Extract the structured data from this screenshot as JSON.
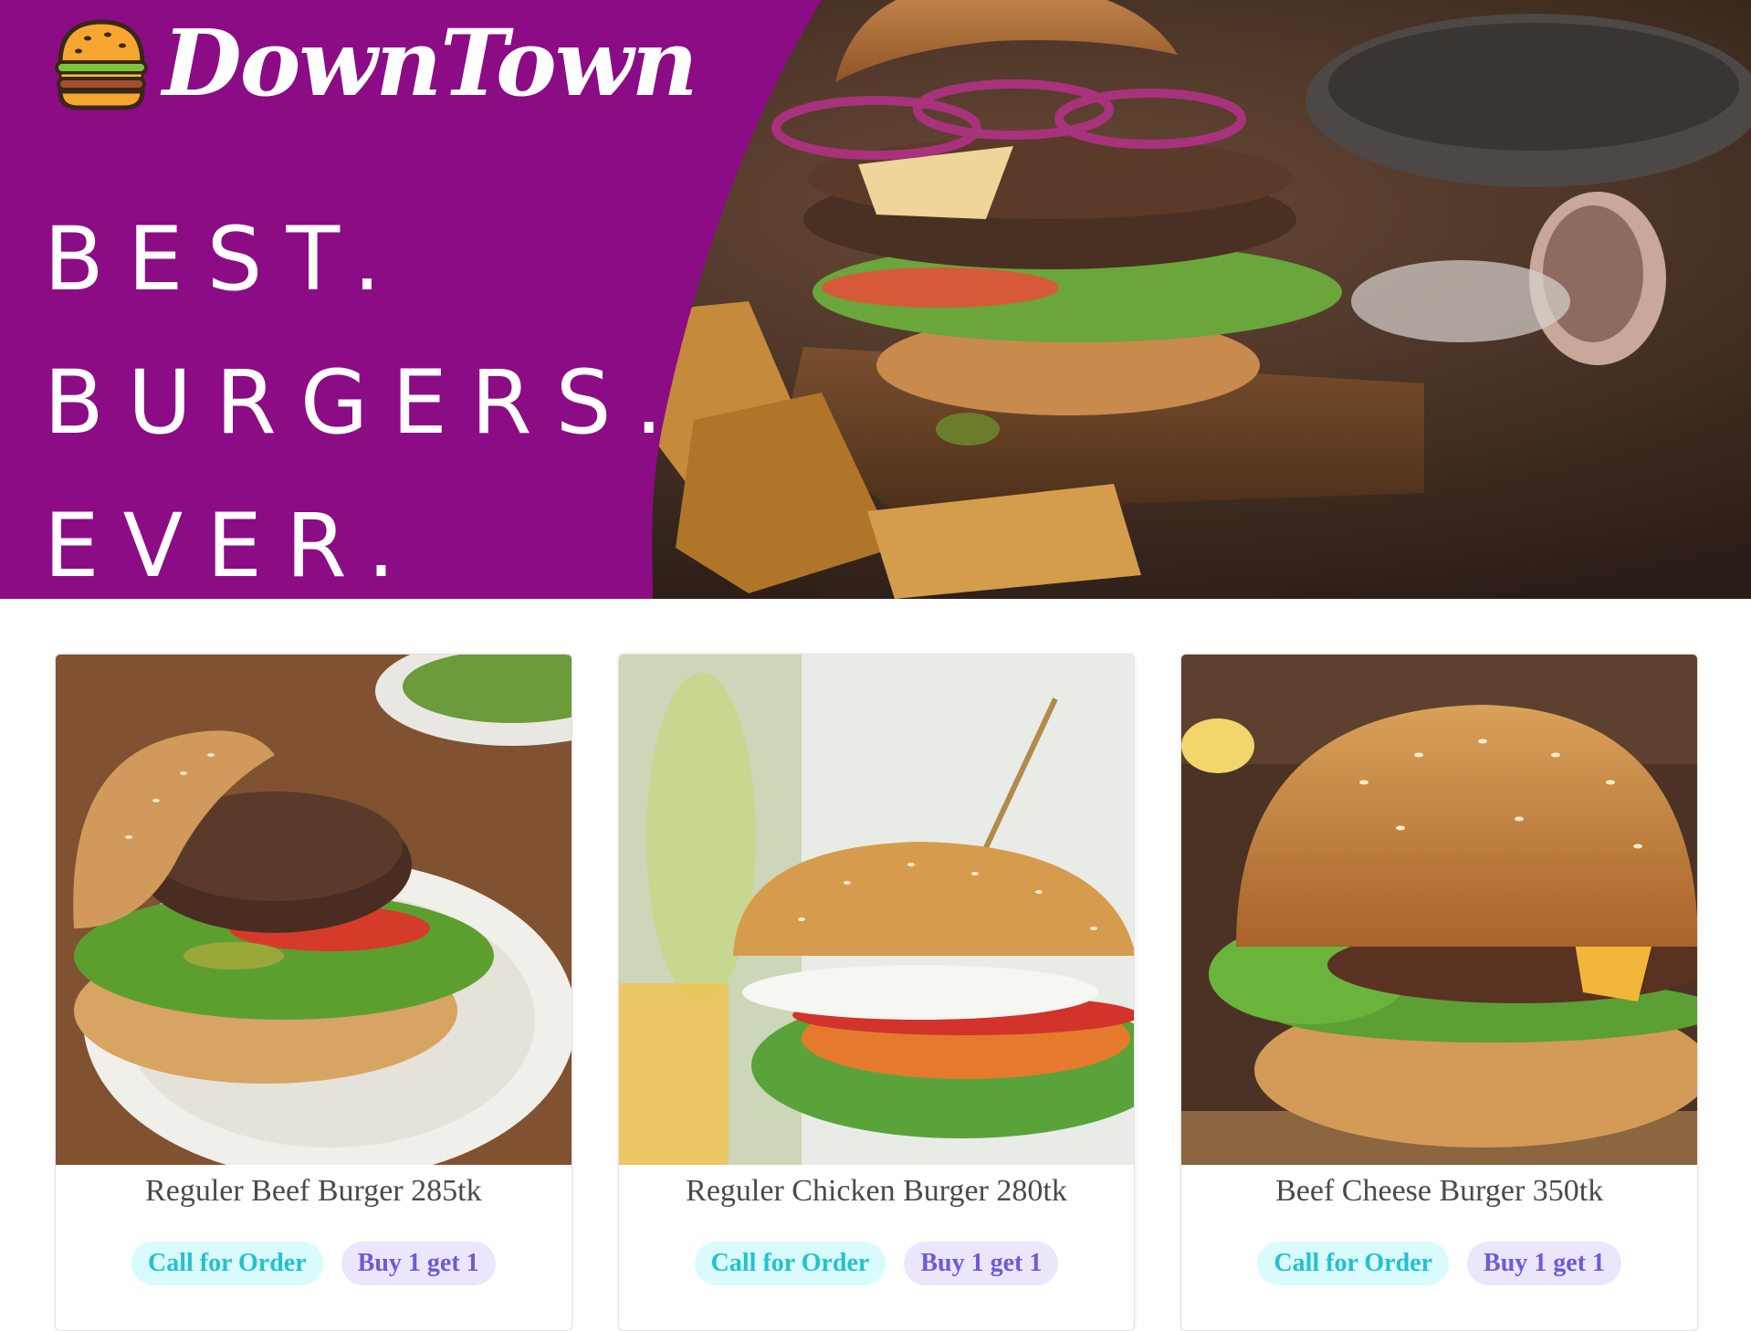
{
  "brand": {
    "name": "DownTown",
    "icon": "burger-icon",
    "purple": "#8b0c85"
  },
  "tagline": {
    "line1": "BEST.",
    "line2": "BURGERS.",
    "line3": "EVER."
  },
  "products": [
    {
      "title": "Reguler Beef Burger 285tk",
      "call_label": "Call for Order",
      "offer_label": "Buy 1 get 1"
    },
    {
      "title": "Reguler Chicken Burger 280tk",
      "call_label": "Call for Order",
      "offer_label": "Buy 1 get 1"
    },
    {
      "title": "Beef Cheese Burger 350tk",
      "call_label": "Call for Order",
      "offer_label": "Buy 1 get 1"
    }
  ],
  "colors": {
    "call_text": "#22c1cf",
    "call_bg": "#d9fbfd",
    "offer_text": "#6d5bd6",
    "offer_bg": "#ebe6fb"
  }
}
